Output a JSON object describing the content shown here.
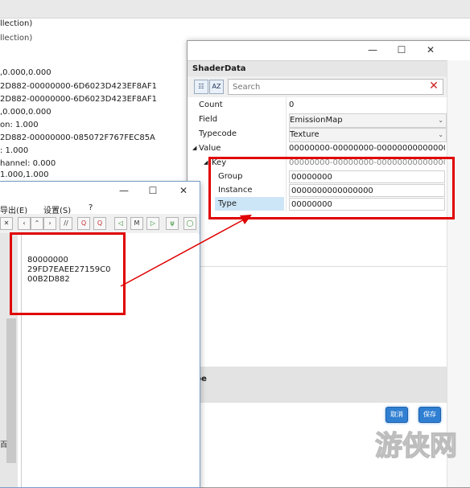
{
  "background_window": {
    "line1": "llection)",
    "line2": "llection)",
    "rows": [
      ",0.000,0.000",
      "2D882-00000000-6D6023D423EF8AF1",
      "2D882-00000000-6D6023D423EF8AF1",
      ",0.000,0.000",
      "on:  1.000",
      "2D882-00000000-085072F767FEC85A",
      ":  1.000",
      "hannel:  0.000",
      "1.000,1.000"
    ]
  },
  "shader_dialog": {
    "title_minimize": "—",
    "title_maximize": "☐",
    "title_close": "✕",
    "header": "ShaderData",
    "search_placeholder": "Search",
    "clear_glyph": "✕",
    "tool_categorized": "☷",
    "tool_sort": "AZ",
    "properties": [
      {
        "label": "Count",
        "value": "0"
      },
      {
        "label": "Field",
        "value": "EmissionMap"
      },
      {
        "label": "Typecode",
        "value": "Texture"
      },
      {
        "label": "Value",
        "value": "00000000-00000000-0000000000000000"
      },
      {
        "label": "Key",
        "value": "00000000-00000000-0000000000000000"
      },
      {
        "label": "Group",
        "value": "00000000"
      },
      {
        "label": "Instance",
        "value": "0000000000000000"
      },
      {
        "label": "Type",
        "value": "00000000"
      }
    ],
    "expand_glyph": "◢",
    "dropdown_glyph": "⌄",
    "desc_title": "pe",
    "cancel_label": "取消",
    "save_label": "保存"
  },
  "hex_editor": {
    "title_minimize": "—",
    "title_maximize": "☐",
    "title_close": "✕",
    "menu": [
      "导出(E)",
      "设置(S)",
      "?"
    ],
    "toolbar": [
      "✕",
      "‹",
      "⌃",
      "›",
      "//",
      "Q",
      "Q",
      "◁",
      "M",
      "▷",
      "ψ",
      "◯"
    ],
    "hex_lines": [
      "80000000",
      "29FD7EAEE27159C0",
      "00B2D882"
    ],
    "side_char": "百"
  },
  "watermark_text": "游侠网",
  "colors": {
    "annotation_red": "#e00000",
    "accent_blue": "#2f7fd2",
    "selected_row": "#cde6f7"
  }
}
